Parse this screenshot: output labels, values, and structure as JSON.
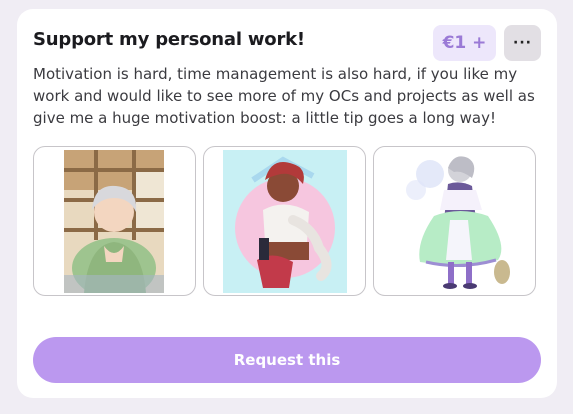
{
  "card": {
    "title": "Support my personal work!",
    "price": "€1 +",
    "more_label": "···",
    "description": "Motivation is hard, time management is also hard, if you like my work and would like to see more of my OCs and projects as well as give me a huge motivation boost: a little tip goes a long way!",
    "request_label": "Request this"
  },
  "colors": {
    "accent": "#bb98ef",
    "badge_bg": "#ede7fb",
    "badge_text": "#9a7ad6",
    "page_bg": "#f0edf4"
  }
}
